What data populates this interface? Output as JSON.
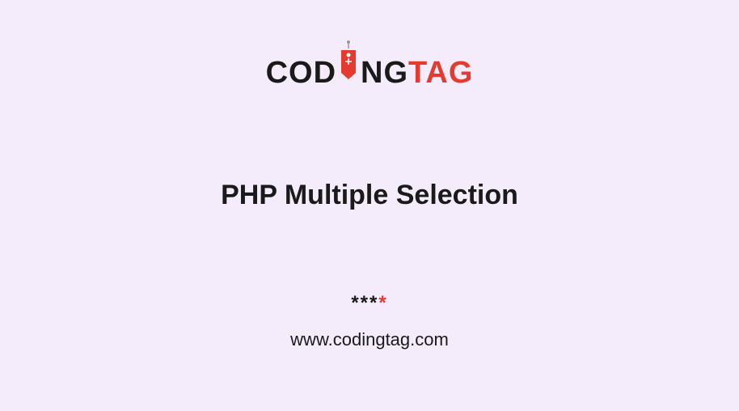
{
  "logo": {
    "part1": "COD",
    "part2": "NG",
    "part3": "TAG",
    "icon_name": "tag-icon"
  },
  "title": "PHP Multiple Selection",
  "asterisks": {
    "black_count": 3,
    "red_count": 1
  },
  "url": "www.codingtag.com"
}
